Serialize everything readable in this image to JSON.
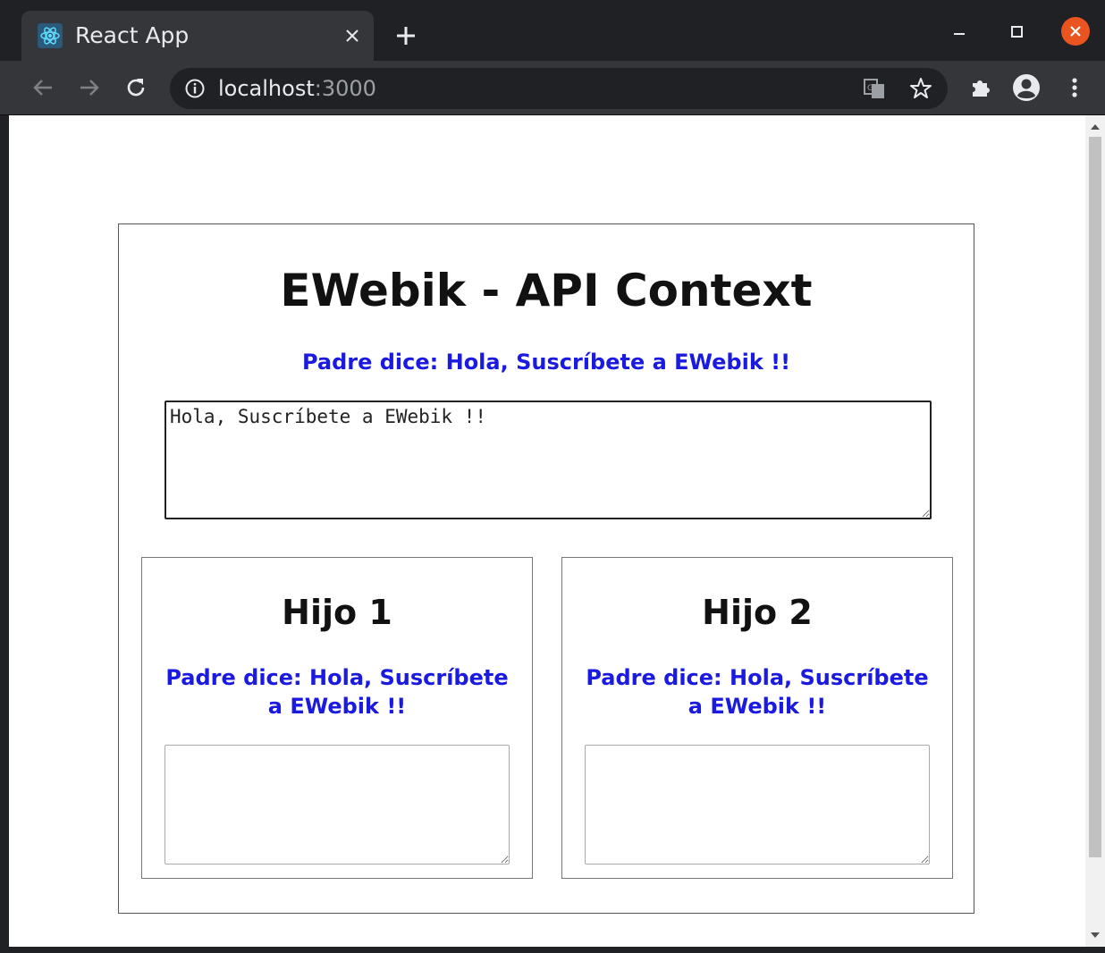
{
  "browser": {
    "tab_title": "React App",
    "tab_close_icon": "×",
    "new_tab_icon": "plus-icon",
    "url_host": "localhost",
    "url_port": ":3000",
    "close_color": "#e95420"
  },
  "app": {
    "title": "EWebik - API Context",
    "parent_says": "Padre dice: Hola, Suscríbete a EWebik !!",
    "parent_textarea_value": "Hola, Suscríbete a EWebik !!",
    "says_color": "#1a1ae0"
  },
  "children": [
    {
      "title": "Hijo 1",
      "says": "Padre dice: Hola, Suscríbete a EWebik !!",
      "textarea_value": ""
    },
    {
      "title": "Hijo 2",
      "says": "Padre dice: Hola, Suscríbete a EWebik !!",
      "textarea_value": ""
    }
  ]
}
